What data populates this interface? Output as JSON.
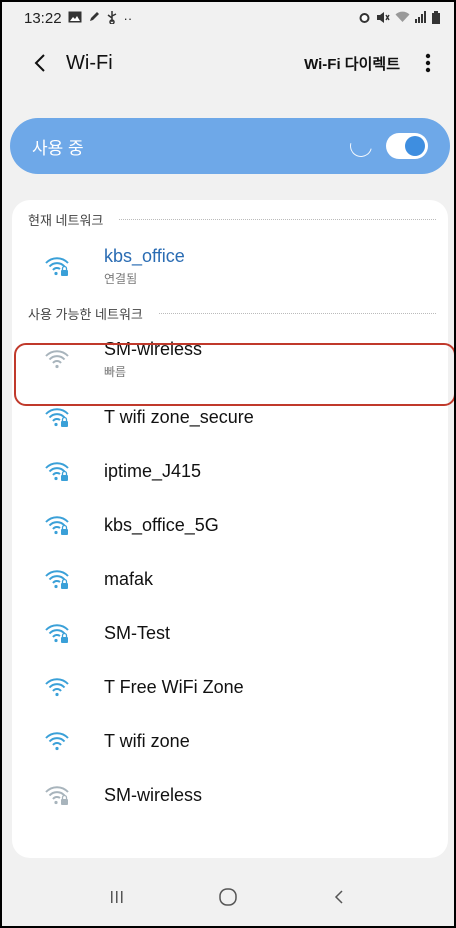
{
  "status_bar": {
    "time": "13:22",
    "left_icons": [
      "image-icon",
      "edit-icon",
      "usb-icon",
      "more-dots-icon"
    ],
    "right_icons": [
      "alarm-icon",
      "mute-icon",
      "wifi-icon",
      "signal-icon",
      "battery-icon"
    ]
  },
  "app_bar": {
    "title": "Wi-Fi",
    "direct_label": "Wi-Fi 다이렉트"
  },
  "wifi_toggle": {
    "label": "사용 중",
    "enabled": true,
    "colors": {
      "bar": "#6ea8e8",
      "knob": "#3e8ee0"
    }
  },
  "current_network": {
    "header": "현재 네트워크",
    "name": "kbs_office",
    "status": "연결됨",
    "secured": true
  },
  "available": {
    "header": "사용 가능한 네트워크",
    "networks": [
      {
        "name": "SM-wireless",
        "sub": "빠름",
        "secured": false,
        "highlighted": true
      },
      {
        "name": "T wifi zone_secure",
        "secured": true
      },
      {
        "name": "iptime_J415",
        "secured": true
      },
      {
        "name": "kbs_office_5G",
        "secured": true
      },
      {
        "name": "mafak",
        "secured": true
      },
      {
        "name": "SM-Test",
        "secured": true
      },
      {
        "name": "T Free WiFi Zone",
        "secured": false
      },
      {
        "name": "T wifi zone",
        "secured": false
      },
      {
        "name": "SM-wireless",
        "secured": true
      }
    ]
  },
  "nav_bar": {
    "buttons": [
      "recents-icon",
      "home-icon",
      "back-icon"
    ]
  }
}
